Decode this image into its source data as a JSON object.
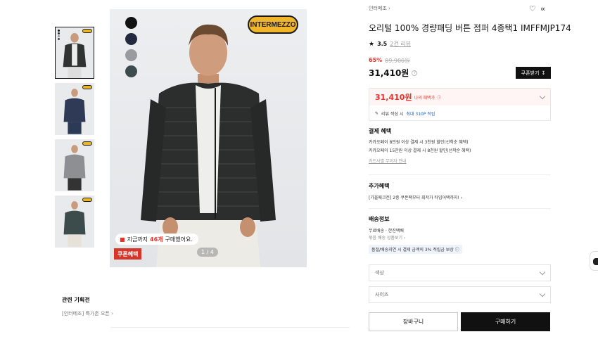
{
  "thumbnails": [
    {
      "color": "#2f3432",
      "active": true
    },
    {
      "color": "#2f3b56",
      "active": false
    },
    {
      "color": "#8d8f92",
      "active": false
    },
    {
      "color": "#3c4b4c",
      "active": false
    }
  ],
  "main_image": {
    "color_options": [
      "#121212",
      "#232a40",
      "#9a9ba0",
      "#3d4b4f"
    ],
    "brand_logo": "INTERMEZZO",
    "buy_count": {
      "prefix": "지금까지",
      "count": "46개",
      "suffix": "구매했어요."
    },
    "coupon_badge": "쿠폰혜택",
    "pager": "1 / 4"
  },
  "related": {
    "title": "관련 기획전",
    "link": "[인터메조] 특가존 오픈"
  },
  "product": {
    "breadcrumb": "인터메조",
    "title": "오리털 100% 경량패딩 버튼 점퍼 4종택1 IMFFMJP174",
    "rating": "3.5",
    "review_count": "2건 리뷰",
    "discount_pct": "65%",
    "original_price": "89,900원",
    "price": "31,410원",
    "coupon_button": "쿠폰받기",
    "benefit_price": "31,410원",
    "benefit_label": "나의 혜택가",
    "review_point_prefix": "리뷰 작성 시",
    "review_point": "최대 310P 적립"
  },
  "payment": {
    "title": "결제 혜택",
    "lines": [
      "카카오페이 8만원 이상 결제 시 3천원 할인(선착순 혜택)",
      "카카오페이 15만원 이상 결제 시 8천원 할인(선착순 혜택)"
    ],
    "link": "카드사별 무이자 안내"
  },
  "extra": {
    "title": "추가혜택",
    "line": "[가을패크전] 2종 쿠폰팩부터 최저가 타임어택까지!"
  },
  "shipping": {
    "title": "배송정보",
    "line1": "무료배송 · 한진택배",
    "line2": "묶음 배송 상품보기",
    "badge": "품절/배송지연 시 결제 금액의 3% 적립금 보상"
  },
  "options": {
    "color": "색상",
    "size": "사이즈"
  },
  "actions": {
    "cart": "장바구니",
    "buy": "구매하기"
  }
}
